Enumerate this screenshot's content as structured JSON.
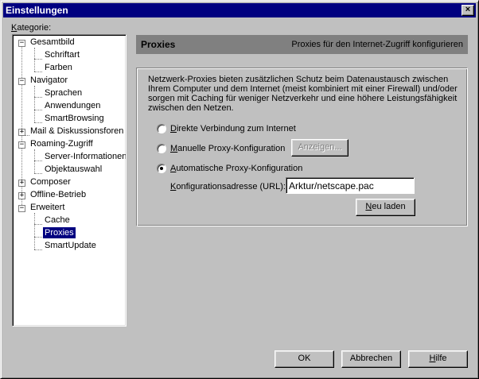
{
  "window": {
    "title": "Einstellungen",
    "close_glyph": "×"
  },
  "category_label": "Kategorie:",
  "tree": {
    "gesamtbild": {
      "label": "Gesamtbild",
      "children": [
        "Schriftart",
        "Farben"
      ]
    },
    "navigator": {
      "label": "Navigator",
      "children": [
        "Sprachen",
        "Anwendungen",
        "SmartBrowsing"
      ]
    },
    "mail": {
      "label": "Mail & Diskussionsforen"
    },
    "roaming": {
      "label": "Roaming-Zugriff",
      "children": [
        "Server-Informationen",
        "Objektauswahl"
      ]
    },
    "composer": {
      "label": "Composer"
    },
    "offline": {
      "label": "Offline-Betrieb"
    },
    "erweitert": {
      "label": "Erweitert",
      "children": [
        "Cache",
        "Proxies",
        "SmartUpdate"
      ]
    },
    "selected": "Proxies"
  },
  "panel": {
    "title": "Proxies",
    "subtitle": "Proxies für den Internet-Zugriff konfigurieren",
    "description": "Netzwerk-Proxies bieten zusätzlichen Schutz beim Datenaustausch zwischen Ihrem Computer und dem Internet (meist kombiniert mit einer Firewall) und/oder sorgen mit Caching für weniger Netzverkehr und eine höhere Leistungsfähigkeit zwischen den Netzen.",
    "options": [
      {
        "label": "Direkte Verbindung zum Internet",
        "selected": false
      },
      {
        "label": "Manuelle Proxy-Konfiguration",
        "selected": false
      },
      {
        "label": "Automatische Proxy-Konfiguration",
        "selected": true
      }
    ],
    "show_button": "Anzeigen...",
    "config_url_label": "Konfigurationsadresse (URL):",
    "config_url_value": "Arktur/netscape.pac",
    "reload_button": "Neu laden"
  },
  "buttons": {
    "ok": "OK",
    "cancel": "Abbrechen",
    "help": "Hilfe"
  },
  "colors": {
    "titlebar": "#000080",
    "selection": "#000080",
    "header_bar": "#808080",
    "face": "#c0c0c0"
  }
}
